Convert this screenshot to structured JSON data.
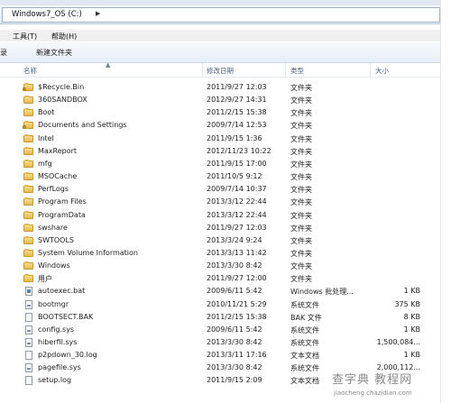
{
  "address": {
    "path": "Windows7_OS (C:)"
  },
  "menu": {
    "tools": "工具(T)",
    "help": "帮助(H)"
  },
  "toolbar": {
    "left_partial": "录",
    "new_folder": "新建文件夹"
  },
  "columns": {
    "name": "名称",
    "date": "修改日期",
    "type": "类型",
    "size": "大小"
  },
  "files": [
    {
      "name": "$Recycle.Bin",
      "date": "2011/9/27 12:03",
      "type": "文件夹",
      "size": "",
      "icon": "locked-folder-icon"
    },
    {
      "name": "360SANDBOX",
      "date": "2012/9/27 14:31",
      "type": "文件夹",
      "size": "",
      "icon": "folder-icon"
    },
    {
      "name": "Boot",
      "date": "2011/2/15 15:38",
      "type": "文件夹",
      "size": "",
      "icon": "folder-icon"
    },
    {
      "name": "Documents and Settings",
      "date": "2009/7/14 12:53",
      "type": "文件夹",
      "size": "",
      "icon": "locked-folder-icon"
    },
    {
      "name": "Intel",
      "date": "2011/9/15 1:36",
      "type": "文件夹",
      "size": "",
      "icon": "folder-icon"
    },
    {
      "name": "MaxReport",
      "date": "2012/11/23 10:22",
      "type": "文件夹",
      "size": "",
      "icon": "folder-icon"
    },
    {
      "name": "mfg",
      "date": "2011/9/15 17:00",
      "type": "文件夹",
      "size": "",
      "icon": "folder-icon"
    },
    {
      "name": "MSOCache",
      "date": "2011/10/5 9:12",
      "type": "文件夹",
      "size": "",
      "icon": "folder-icon"
    },
    {
      "name": "PerfLogs",
      "date": "2009/7/14 10:37",
      "type": "文件夹",
      "size": "",
      "icon": "folder-icon"
    },
    {
      "name": "Program Files",
      "date": "2013/3/12 22:44",
      "type": "文件夹",
      "size": "",
      "icon": "folder-icon"
    },
    {
      "name": "ProgramData",
      "date": "2013/3/12 22:44",
      "type": "文件夹",
      "size": "",
      "icon": "folder-icon"
    },
    {
      "name": "swshare",
      "date": "2011/9/27 12:03",
      "type": "文件夹",
      "size": "",
      "icon": "folder-icon"
    },
    {
      "name": "SWTOOLS",
      "date": "2013/3/24 9:24",
      "type": "文件夹",
      "size": "",
      "icon": "folder-icon"
    },
    {
      "name": "System Volume Information",
      "date": "2013/3/13 11:42",
      "type": "文件夹",
      "size": "",
      "icon": "folder-icon"
    },
    {
      "name": "Windows",
      "date": "2013/3/30 8:42",
      "type": "文件夹",
      "size": "",
      "icon": "folder-icon"
    },
    {
      "name": "用户",
      "date": "2011/9/27 12:00",
      "type": "文件夹",
      "size": "",
      "icon": "folder-icon"
    },
    {
      "name": "autoexec.bat",
      "date": "2009/6/11 5:42",
      "type": "Windows 批处理...",
      "size": "1 KB",
      "icon": "batch-file-icon"
    },
    {
      "name": "bootmgr",
      "date": "2010/11/21 5:29",
      "type": "系统文件",
      "size": "375 KB",
      "icon": "system-file-icon"
    },
    {
      "name": "BOOTSECT.BAK",
      "date": "2011/2/15 15:38",
      "type": "BAK 文件",
      "size": "8 KB",
      "icon": "file-icon"
    },
    {
      "name": "config.sys",
      "date": "2009/6/11 5:42",
      "type": "系统文件",
      "size": "1 KB",
      "icon": "system-file-icon"
    },
    {
      "name": "hiberfil.sys",
      "date": "2013/3/30 8:42",
      "type": "系统文件",
      "size": "1,500,084...",
      "icon": "system-file-icon"
    },
    {
      "name": "p2pdown_30.log",
      "date": "2013/3/11 17:16",
      "type": "文本文档",
      "size": "1 KB",
      "icon": "text-file-icon"
    },
    {
      "name": "pagefile.sys",
      "date": "2013/3/30 8:42",
      "type": "系统文件",
      "size": "2,000,112...",
      "icon": "system-file-icon"
    },
    {
      "name": "setup.log",
      "date": "2011/9/15 2:09",
      "type": "文本文档",
      "size": "",
      "icon": "text-file-icon"
    }
  ],
  "watermark": {
    "main": "查字典 教程网",
    "sub": "jiaocheng.chazidian.com"
  }
}
